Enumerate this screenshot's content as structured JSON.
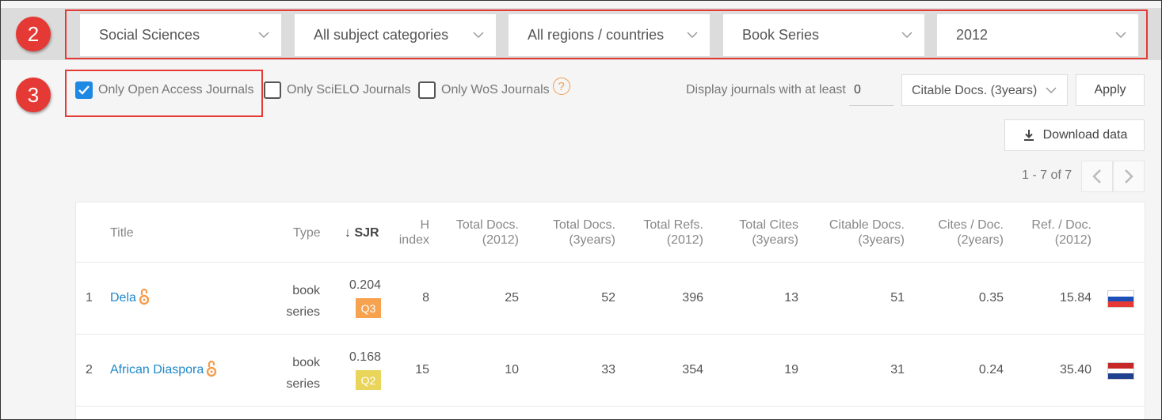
{
  "badges": {
    "filters": "2",
    "options": "3"
  },
  "filters": [
    {
      "label": "Social Sciences"
    },
    {
      "label": "All subject categories"
    },
    {
      "label": "All regions / countries"
    },
    {
      "label": "Book Series"
    },
    {
      "label": "2012"
    }
  ],
  "options": {
    "open_access": {
      "label": "Only Open Access Journals",
      "checked": true
    },
    "scielo": {
      "label": "Only SciELO Journals",
      "checked": false
    },
    "wos": {
      "label": "Only WoS Journals",
      "checked": false
    },
    "help_icon": "?",
    "min_label": "Display journals with at least",
    "min_value": "0",
    "citable_select": "Citable Docs. (3years)",
    "apply_label": "Apply",
    "download_label": "Download data"
  },
  "pager": {
    "text": "1 - 7 of 7"
  },
  "table": {
    "headers": {
      "title": "Title",
      "type": "Type",
      "sjr": "↓ SJR",
      "h1": "H",
      "h2": "index",
      "td1": "Total Docs.",
      "td2": "(2012)",
      "td3y1": "Total Docs.",
      "td3y2": "(3years)",
      "tr1": "Total Refs.",
      "tr2": "(2012)",
      "tc1": "Total Cites",
      "tc2": "(3years)",
      "cd1": "Citable Docs.",
      "cd2": "(3years)",
      "cpd1": "Cites / Doc.",
      "cpd2": "(2years)",
      "rpd1": "Ref. / Doc.",
      "rpd2": "(2012)"
    },
    "rows": [
      {
        "rank": "1",
        "title": "Dela",
        "type1": "book",
        "type2": "series",
        "sjr": "0.204",
        "quartile": "Q3",
        "quartile_color": "#f7a24f",
        "h": "8",
        "total_docs": "25",
        "total_docs_3y": "52",
        "total_refs": "396",
        "total_cites": "13",
        "citable_docs": "51",
        "cites_per_doc": "0.35",
        "refs_per_doc": "15.84",
        "flag": "slovenia-flag"
      },
      {
        "rank": "2",
        "title": "African Diaspora",
        "type1": "book",
        "type2": "series",
        "sjr": "0.168",
        "quartile": "Q2",
        "quartile_color": "#e8d55a",
        "h": "15",
        "total_docs": "10",
        "total_docs_3y": "33",
        "total_refs": "354",
        "total_cites": "19",
        "citable_docs": "31",
        "cites_per_doc": "0.24",
        "refs_per_doc": "35.40",
        "flag": "netherlands-flag"
      }
    ]
  },
  "colors": {
    "accent_red": "#e53935",
    "link_blue": "#1e88c9",
    "oa_orange": "#f39c4d",
    "checkbox_blue": "#1e88e5"
  }
}
